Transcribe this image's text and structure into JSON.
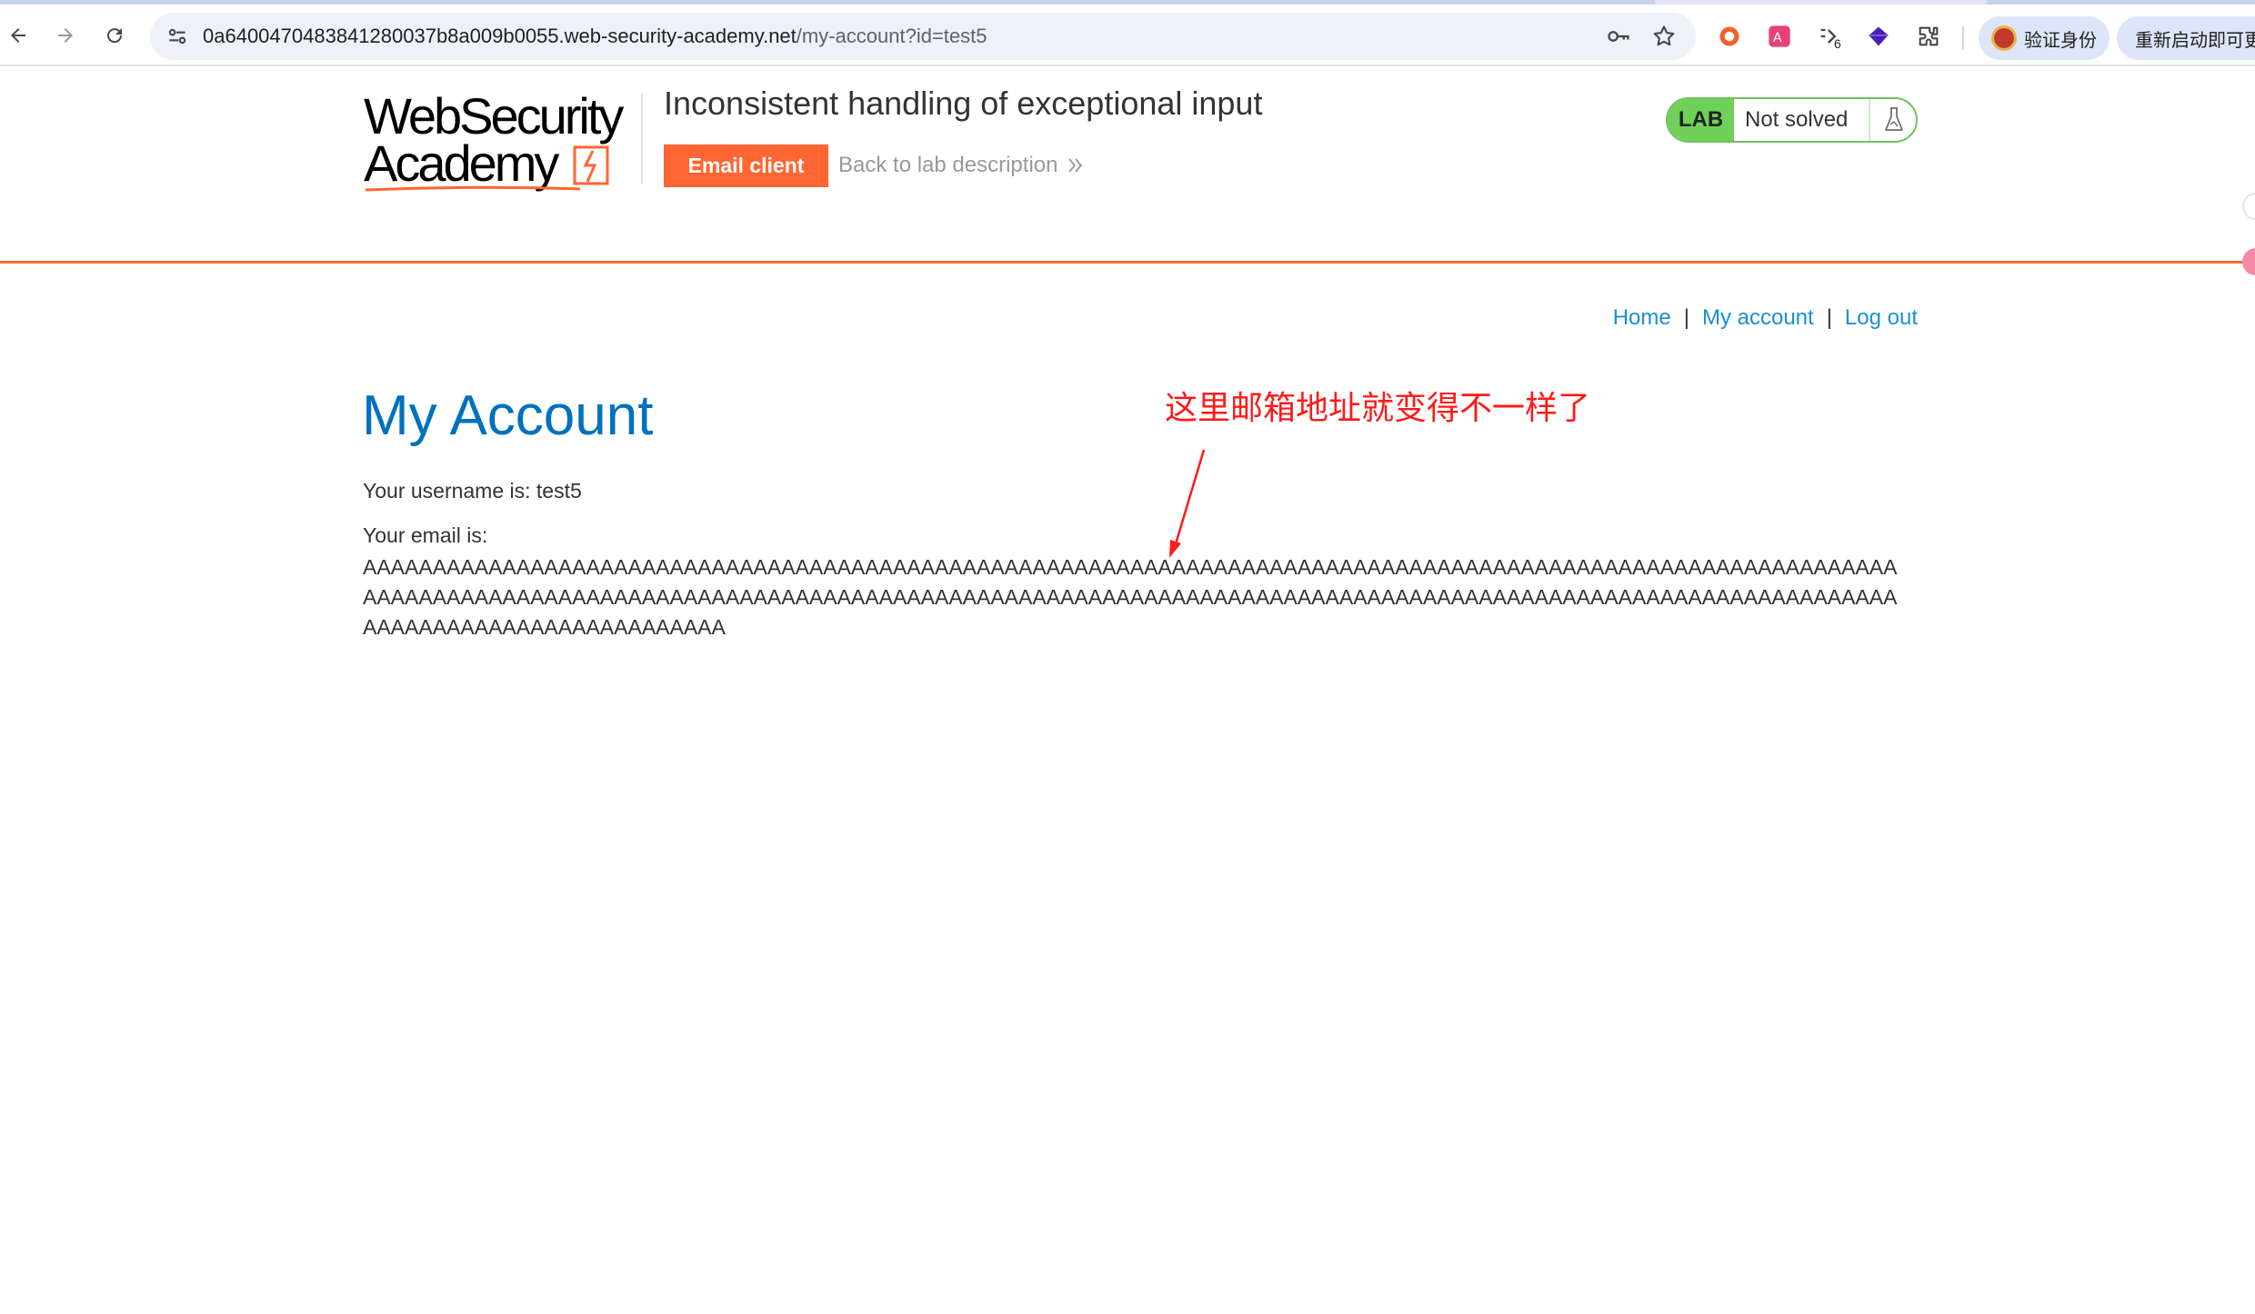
{
  "browser": {
    "url_host": "0a6400470483841280037b8a009b0055.web-security-academy.net",
    "url_path": "/my-account?id=test5",
    "profile_pill_label": "验证身份",
    "update_pill_label": "重新启动即可更新",
    "extension_badge_count": "6"
  },
  "lab": {
    "logo_line1": "WebSecurity",
    "logo_line2": "Academy",
    "title": "Inconsistent handling of exceptional input",
    "email_client_label": "Email client",
    "back_label": "Back to lab description",
    "status_badge": "LAB",
    "status_text": "Not solved"
  },
  "nav": {
    "home": "Home",
    "my_account": "My account",
    "logout": "Log out",
    "separator": "|"
  },
  "account": {
    "heading": "My Account",
    "username_text": "Your username is: test5",
    "email_label": "Your email is:",
    "email_value": "AAAAAAAAAAAAAAAAAAAAAAAAAAAAAAAAAAAAAAAAAAAAAAAAAAAAAAAAAAAAAAAAAAAAAAAAAAAAAAAAAAAAAAAAAAAAAAAAAAAAAAAAAAAAAAAAAAAAAAAAAAAAAAAAAAAAAAAAAAAAAAAAAAAAAAAAAAAAAAAAAAAAAAAAAAAAAAAAAAAAAAAAAAAAAAAAAAAAAAAAAAAAAAAAAAAAAAAAAAAAAAAAAAAAAAAAAAAAAAAAAAAAAA"
  },
  "annotation": {
    "text": "这里邮箱地址就变得不一样了",
    "color": "#ff1a1a"
  },
  "colors": {
    "accent_orange": "#ff6633",
    "link_blue": "#1a8fd4",
    "heading_blue": "#0071bc",
    "lab_green": "#70d15a"
  }
}
